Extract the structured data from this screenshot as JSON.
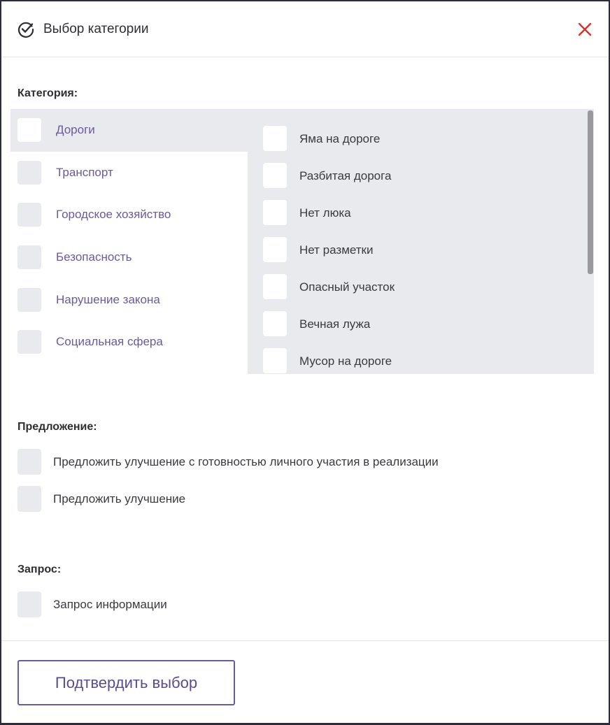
{
  "header": {
    "title": "Выбор категории",
    "icon": "check-circle-icon",
    "close_icon": "close-icon"
  },
  "category_section": {
    "label": "Категория:",
    "categories": [
      {
        "label": "Дороги",
        "selected": true
      },
      {
        "label": "Транспорт",
        "selected": false
      },
      {
        "label": "Городское хозяйство",
        "selected": false
      },
      {
        "label": "Безопасность",
        "selected": false
      },
      {
        "label": "Нарушение закона",
        "selected": false
      },
      {
        "label": "Социальная сфера",
        "selected": false
      }
    ],
    "subcategories": [
      {
        "label": "Яма на дороге"
      },
      {
        "label": "Разбитая дорога"
      },
      {
        "label": "Нет люка"
      },
      {
        "label": "Нет разметки"
      },
      {
        "label": "Опасный участок"
      },
      {
        "label": "Вечная лужа"
      },
      {
        "label": "Мусор на дороге"
      }
    ]
  },
  "proposal_section": {
    "label": "Предложение:",
    "options": [
      {
        "label": "Предложить улучшение с готовностью личного участия в реализации"
      },
      {
        "label": "Предложить улучшение"
      }
    ]
  },
  "request_section": {
    "label": "Запрос:",
    "options": [
      {
        "label": "Запрос информации"
      }
    ]
  },
  "footer": {
    "confirm_label": "Подтвердить выбор"
  },
  "colors": {
    "accent": "#6a5a9e",
    "close": "#d0342c",
    "panel_bg": "#e8eaee"
  }
}
